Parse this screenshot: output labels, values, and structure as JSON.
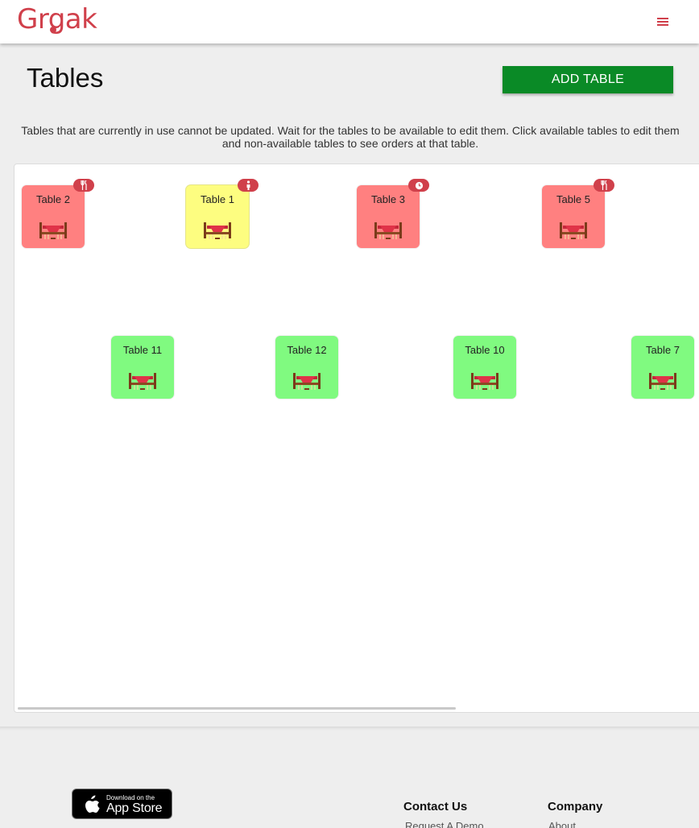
{
  "header": {
    "logo_text": "Grgak",
    "menu_icon": "hamburger-menu-icon",
    "brand_color": "#d0404b"
  },
  "page": {
    "title": "Tables",
    "add_button_label": "ADD TABLE",
    "notice": "Tables that are currently in use cannot be updated. Wait for the tables to be available to edit them. Click available tables to edit them and non-available tables to see orders at that table."
  },
  "tables": [
    {
      "label": "Table 2",
      "status": "red",
      "badge_icon": "fork-knife-icon"
    },
    {
      "label": "Table 1",
      "status": "yellow",
      "badge_icon": "person-icon"
    },
    {
      "label": "Table 3",
      "status": "red",
      "badge_icon": "clock-icon"
    },
    {
      "label": "Table 5",
      "status": "red",
      "badge_icon": "fork-knife-icon"
    },
    {
      "label": "Table 11",
      "status": "green"
    },
    {
      "label": "Table 12",
      "status": "green"
    },
    {
      "label": "Table 10",
      "status": "green"
    },
    {
      "label": "Table 7",
      "status": "green"
    }
  ],
  "status_colors": {
    "red": "#ff8080",
    "yellow": "#fdfd80",
    "green": "#80fa80"
  },
  "footer": {
    "appstore_small": "Download on the",
    "appstore_big": "App Store",
    "contact_heading": "Contact Us",
    "contact_link": "Request A Demo",
    "company_heading": "Company",
    "company_link": "About"
  }
}
